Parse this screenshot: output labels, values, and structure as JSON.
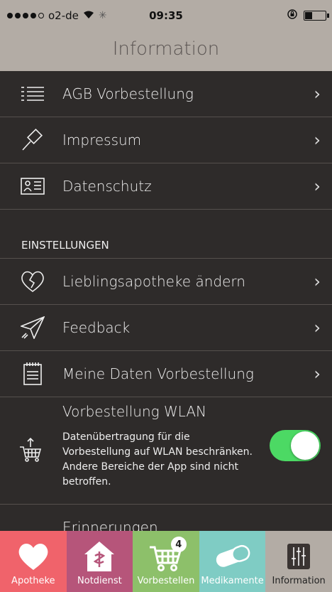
{
  "status": {
    "carrier": "o2-de",
    "time": "09:35"
  },
  "nav": {
    "title": "Information"
  },
  "menu": [
    {
      "label": "AGB Vorbestellung",
      "icon": "list-icon"
    },
    {
      "label": "Impressum",
      "icon": "gavel-icon"
    },
    {
      "label": "Datenschutz",
      "icon": "id-card-icon"
    }
  ],
  "settings": {
    "header": "EINSTELLUNGEN",
    "items": [
      {
        "label": "Lieblingsapotheke ändern",
        "icon": "broken-heart-icon"
      },
      {
        "label": "Feedback",
        "icon": "paper-plane-icon"
      },
      {
        "label": "Meine Daten Vorbestellung",
        "icon": "notepad-icon"
      }
    ],
    "wlan": {
      "title": "Vorbestellung WLAN",
      "description": "Datenübertragung für die Vorbestellung auf WLAN beschränken. Andere Bereiche der App sind nicht betroffen.",
      "enabled": true
    },
    "partial_label": "Erinnerungen"
  },
  "tabs": [
    {
      "label": "Apotheke",
      "color": "#f0636b",
      "icon": "heart-icon"
    },
    {
      "label": "Notdienst",
      "color": "#b6557a",
      "icon": "pharmacy-house-icon"
    },
    {
      "label": "Vorbestellen",
      "color": "#8dc06a",
      "icon": "cart-icon",
      "badge": "4"
    },
    {
      "label": "Medikamente",
      "color": "#7fccc4",
      "icon": "pill-icon"
    },
    {
      "label": "Information",
      "color": "#b3aca5",
      "icon": "sliders-icon"
    }
  ]
}
